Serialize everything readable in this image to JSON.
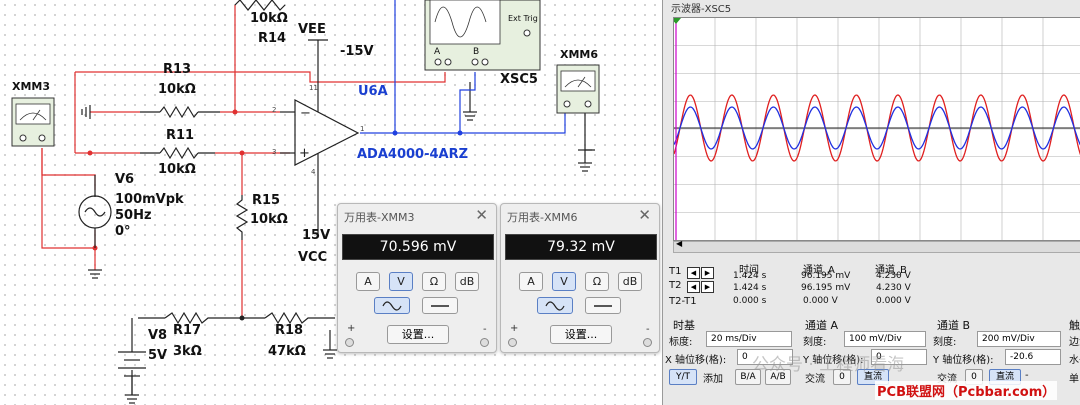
{
  "schematic": {
    "components": {
      "r_top": {
        "value": "10kΩ"
      },
      "vee": {
        "name": "VEE",
        "value": "-15V"
      },
      "r14": {
        "name": "R14"
      },
      "r13": {
        "name": "R13",
        "value": "10kΩ"
      },
      "r11": {
        "name": "R11",
        "value": "10kΩ"
      },
      "r15": {
        "name": "R15",
        "value": "10kΩ"
      },
      "r17": {
        "name": "R17",
        "value": "3kΩ"
      },
      "r18": {
        "name": "R18",
        "value": "47kΩ"
      },
      "v6": {
        "name": "V6",
        "amplitude": "100mVpk",
        "freq": "50Hz",
        "phase": "0°"
      },
      "v8": {
        "name": "V8",
        "value": "5V"
      },
      "vcc": {
        "name": "VCC",
        "value": "15V"
      },
      "u6a": {
        "name": "U6A",
        "part": "ADA4000-4ARZ"
      },
      "xmm3": {
        "name": "XMM3"
      },
      "xmm6": {
        "name": "XMM6"
      },
      "xsc5": {
        "name": "XSC5",
        "ext_trig": "Ext Trig",
        "ch_a": "A",
        "ch_b": "B"
      }
    },
    "pins": {
      "inv": "2",
      "noninv": "3",
      "out": "1",
      "vplus": "4",
      "vminus": "11"
    }
  },
  "meters": [
    {
      "title": "万用表-XMM3",
      "reading": "70.596 mV",
      "mode_buttons": [
        "A",
        "V",
        "Ω",
        "dB"
      ],
      "active": "V",
      "settings_label": "设置...",
      "plus": "+",
      "minus": "-"
    },
    {
      "title": "万用表-XMM6",
      "reading": "79.32 mV",
      "mode_buttons": [
        "A",
        "V",
        "Ω",
        "dB"
      ],
      "active": "V",
      "settings_label": "设置...",
      "plus": "+",
      "minus": "-"
    }
  ],
  "scope": {
    "title": "示波器-XSC5",
    "readout": {
      "headers": [
        "时间",
        "通道_A",
        "通道_B"
      ],
      "rows": [
        {
          "label": "T1",
          "time": "1.424 s",
          "a": "96.195 mV",
          "b": "4.230 V"
        },
        {
          "label": "T2",
          "time": "1.424 s",
          "a": "96.195 mV",
          "b": "4.230 V"
        },
        {
          "label": "T2-T1",
          "time": "0.000 s",
          "a": "0.000 V",
          "b": "0.000 V"
        }
      ]
    },
    "timebase": {
      "title": "时基",
      "scale_label": "标度:",
      "scale": "20 ms/Div",
      "xpos_label": "X 轴位移(格):",
      "xpos": "0",
      "modes": [
        "Y/T",
        "添加",
        "B/A",
        "A/B"
      ],
      "active_mode": "Y/T"
    },
    "channel_a": {
      "title": "通道 A",
      "scale_label": "刻度:",
      "scale": "100 mV/Div",
      "ypos_label": "Y 轴位移(格):",
      "ypos": "0",
      "coupling": [
        "交流",
        "0",
        "直流"
      ],
      "active_coupling": "直流"
    },
    "channel_b": {
      "title": "通道 B",
      "scale_label": "刻度:",
      "scale": "200 mV/Div",
      "ypos_label": "Y 轴位移(格):",
      "ypos": "-20.6",
      "coupling": [
        "交流",
        "0",
        "直流"
      ],
      "active_coupling": "直流",
      "extra": "-"
    },
    "trigger_partial": {
      "title": "触",
      "edge": "边沿",
      "level": "水平",
      "single": "单"
    },
    "trace_colors": {
      "a": "#e02020",
      "b": "#2030e0",
      "cursor": "#cc00cc"
    }
  },
  "watermarks": {
    "wechat": "公众号 · 工程师看海",
    "pcbbar": "PCB联盟网（Pcbbar.com）"
  }
}
